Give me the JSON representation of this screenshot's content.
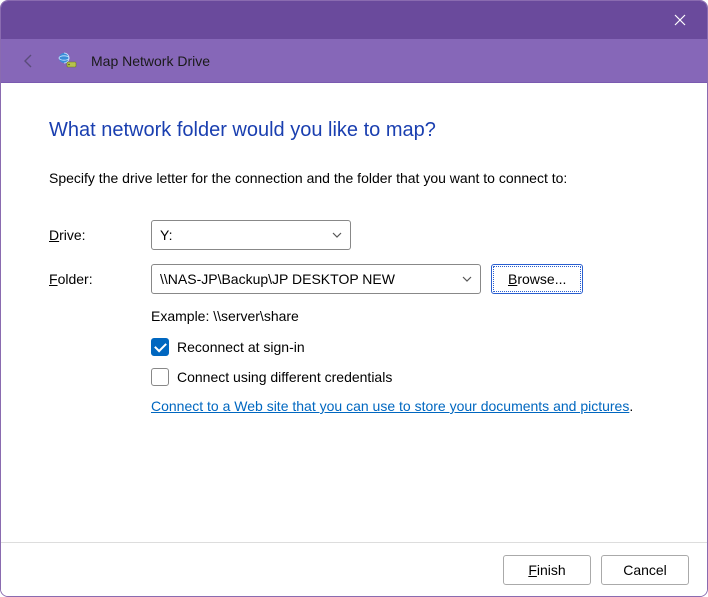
{
  "header": {
    "title": "Map Network Drive"
  },
  "main": {
    "heading": "What network folder would you like to map?",
    "subtext": "Specify the drive letter for the connection and the folder that you want to connect to:",
    "drive_label_u": "D",
    "drive_label_rest": "rive:",
    "drive_value": "Y:",
    "folder_label_u": "F",
    "folder_label_rest": "older:",
    "folder_value": "\\\\NAS-JP\\Backup\\JP DESKTOP NEW",
    "browse_u": "B",
    "browse_rest": "rowse...",
    "example": "Example: \\\\server\\share",
    "reconnect_u": "R",
    "reconnect_rest": "econnect at sign-in",
    "reconnect_checked": true,
    "diffcred_pre": "Connect using different ",
    "diffcred_u": "c",
    "diffcred_post": "redentials",
    "diffcred_checked": false,
    "link_text": "Connect to a Web site that you can use to store your documents and pictures",
    "link_period": "."
  },
  "footer": {
    "finish_u": "F",
    "finish_rest": "inish",
    "cancel": "Cancel"
  }
}
